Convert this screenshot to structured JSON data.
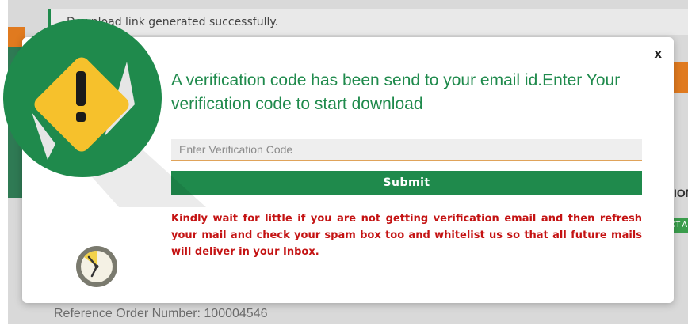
{
  "background": {
    "success_message": "Download link generated successfully.",
    "reference_order": "Reference Order Number: 100004546",
    "right_column_fragment": "ION",
    "right_tag_fragment": "CT A"
  },
  "modal": {
    "close_label": "x",
    "heading": "A verification code has been send to your email id.Enter Your verification code to start download",
    "input": {
      "placeholder": "Enter Verification Code",
      "value": ""
    },
    "submit_label": "Submit",
    "notice": "Kindly wait for little if you are not getting verification email and then refresh your mail and check your spam box too and whitelist us so that all future mails will deliver in your Inbox."
  },
  "icons": {
    "warning": "warning-icon",
    "clock": "clock-icon",
    "close": "close-icon"
  },
  "colors": {
    "accent_green": "#1f8a4c",
    "notice_red": "#c41313",
    "warning_yellow": "#f6c12c",
    "orange": "#e07a1f"
  }
}
